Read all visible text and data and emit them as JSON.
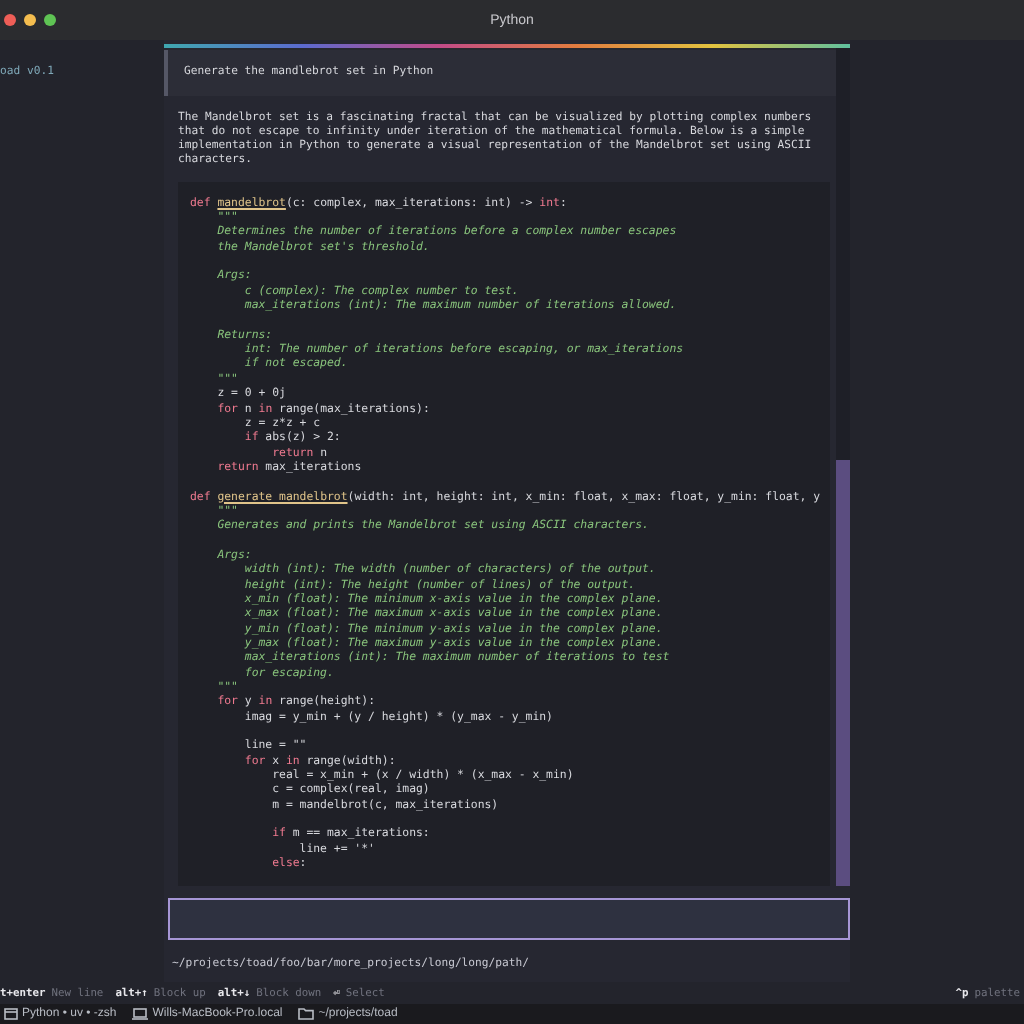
{
  "window": {
    "title": "Python"
  },
  "sidebar": {
    "app_label": "oad v0.1"
  },
  "prompt": {
    "text": "Generate the mandlebrot set in Python"
  },
  "response": {
    "paragraph": "The Mandelbrot set is a fascinating fractal that can be visualized by plotting complex numbers that do not escape to infinity under iteration of the mathematical formula. Below is a simple implementation in Python to generate a visual representation of the Mandelbrot set using ASCII characters.",
    "code_paragraphs": [
      [
        [
          {
            "kind": "keyword",
            "text": "def "
          },
          {
            "kind": "function",
            "text": "mandelbrot"
          },
          {
            "kind": "plain",
            "text": "(c: complex, max_iterations: int) -> "
          },
          {
            "kind": "keyword",
            "text": "int"
          },
          {
            "kind": "plain",
            "text": ":"
          }
        ],
        [
          {
            "kind": "docstring",
            "text": "    \"\"\""
          }
        ],
        [
          {
            "kind": "docstring",
            "text": "    Determines the number of iterations before a complex number escapes"
          }
        ],
        [
          {
            "kind": "docstring",
            "text": "    the Mandelbrot set's threshold."
          }
        ]
      ],
      [
        [
          {
            "kind": "docstring",
            "text": "    Args:"
          }
        ],
        [
          {
            "kind": "docstring",
            "text": "        c (complex): The complex number to test."
          }
        ],
        [
          {
            "kind": "docstring",
            "text": "        max_iterations (int): The maximum number of iterations allowed."
          }
        ]
      ],
      [
        [
          {
            "kind": "docstring",
            "text": "    Returns:"
          }
        ],
        [
          {
            "kind": "docstring",
            "text": "        int: The number of iterations before escaping, or max_iterations"
          }
        ],
        [
          {
            "kind": "docstring",
            "text": "        if not escaped."
          }
        ],
        [
          {
            "kind": "docstring",
            "text": "    \"\"\""
          }
        ],
        [
          {
            "kind": "plain",
            "text": "    z = 0 + 0j"
          }
        ],
        [
          {
            "kind": "keyword",
            "text": "    for"
          },
          {
            "kind": "plain",
            "text": " n "
          },
          {
            "kind": "keyword",
            "text": "in"
          },
          {
            "kind": "plain",
            "text": " range(max_iterations):"
          }
        ],
        [
          {
            "kind": "plain",
            "text": "        z = z*z + c"
          }
        ],
        [
          {
            "kind": "keyword",
            "text": "        if"
          },
          {
            "kind": "plain",
            "text": " abs(z) > 2:"
          }
        ],
        [
          {
            "kind": "keyword",
            "text": "            return"
          },
          {
            "kind": "plain",
            "text": " n"
          }
        ],
        [
          {
            "kind": "keyword",
            "text": "    return"
          },
          {
            "kind": "plain",
            "text": " max_iterations"
          }
        ]
      ],
      [
        [
          {
            "kind": "keyword",
            "text": "def "
          },
          {
            "kind": "function",
            "text": "generate_mandelbrot"
          },
          {
            "kind": "plain",
            "text": "(width: int, height: int, x_min: float, x_max: float, y_min: float, y"
          }
        ],
        [
          {
            "kind": "docstring",
            "text": "    \"\"\""
          }
        ],
        [
          {
            "kind": "docstring",
            "text": "    Generates and prints the Mandelbrot set using ASCII characters."
          }
        ]
      ],
      [
        [
          {
            "kind": "docstring",
            "text": "    Args:"
          }
        ],
        [
          {
            "kind": "docstring",
            "text": "        width (int): The width (number of characters) of the output."
          }
        ],
        [
          {
            "kind": "docstring",
            "text": "        height (int): The height (number of lines) of the output."
          }
        ],
        [
          {
            "kind": "docstring",
            "text": "        x_min (float): The minimum x-axis value in the complex plane."
          }
        ],
        [
          {
            "kind": "docstring",
            "text": "        x_max (float): The maximum x-axis value in the complex plane."
          }
        ],
        [
          {
            "kind": "docstring",
            "text": "        y_min (float): The minimum y-axis value in the complex plane."
          }
        ],
        [
          {
            "kind": "docstring",
            "text": "        y_max (float): The maximum y-axis value in the complex plane."
          }
        ],
        [
          {
            "kind": "docstring",
            "text": "        max_iterations (int): The maximum number of iterations to test"
          }
        ],
        [
          {
            "kind": "docstring",
            "text": "        for escaping."
          }
        ],
        [
          {
            "kind": "docstring",
            "text": "    \"\"\""
          }
        ],
        [
          {
            "kind": "keyword",
            "text": "    for"
          },
          {
            "kind": "plain",
            "text": " y "
          },
          {
            "kind": "keyword",
            "text": "in"
          },
          {
            "kind": "plain",
            "text": " range(height):"
          }
        ],
        [
          {
            "kind": "plain",
            "text": "        imag = y_min + (y / height) * (y_max - y_min)"
          }
        ]
      ],
      [
        [
          {
            "kind": "plain",
            "text": "        line = \"\""
          }
        ],
        [
          {
            "kind": "keyword",
            "text": "        for"
          },
          {
            "kind": "plain",
            "text": " x "
          },
          {
            "kind": "keyword",
            "text": "in"
          },
          {
            "kind": "plain",
            "text": " range(width):"
          }
        ],
        [
          {
            "kind": "plain",
            "text": "            real = x_min + (x / width) * (x_max - x_min)"
          }
        ],
        [
          {
            "kind": "plain",
            "text": "            c = complex(real, imag)"
          }
        ],
        [
          {
            "kind": "plain",
            "text": "            m = mandelbrot(c, max_iterations)"
          }
        ]
      ],
      [
        [
          {
            "kind": "keyword",
            "text": "            if"
          },
          {
            "kind": "plain",
            "text": " m == max_iterations:"
          }
        ],
        [
          {
            "kind": "plain",
            "text": "                line += '*'"
          }
        ],
        [
          {
            "kind": "keyword",
            "text": "            else"
          },
          {
            "kind": "plain",
            "text": ":"
          }
        ]
      ]
    ]
  },
  "path": "~/projects/toad/foo/bar/more_projects/long/long/path/",
  "key_hints": [
    {
      "key": "t+enter",
      "action": "New line"
    },
    {
      "key": "alt+↑",
      "action": "Block up"
    },
    {
      "key": "alt+↓",
      "action": "Block down"
    },
    {
      "key": "⏎",
      "action": "Select"
    }
  ],
  "palette_hint": {
    "key": "^p",
    "action": "palette"
  },
  "status_bar": [
    {
      "kind": "terminal",
      "label": "Python • uv • -zsh"
    },
    {
      "kind": "laptop",
      "label": "Wills-MacBook-Pro.local"
    },
    {
      "kind": "folder",
      "label": "~/projects/toad"
    }
  ]
}
